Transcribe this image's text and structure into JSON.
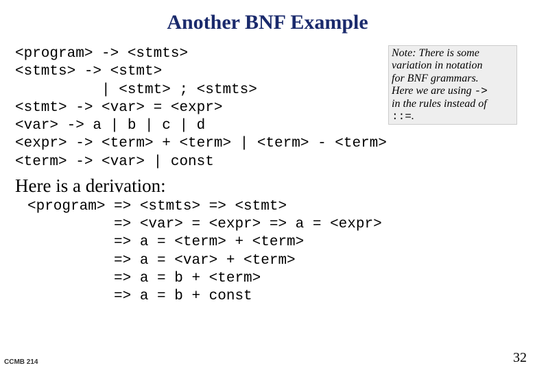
{
  "title": "Another BNF  Example",
  "grammar": [
    "<program> -> <stmts>",
    "<stmts> -> <stmt>",
    "          | <stmt> ; <stmts>",
    "<stmt> -> <var> = <expr>",
    "<var> -> a | b | c | d",
    "<expr> -> <term> + <term> | <term> - <term>",
    "<term> -> <var> | const"
  ],
  "note": {
    "l1": "Note: There is some",
    "l2": "variation in notation",
    "l3": "for BNF grammars.",
    "l4": "Here we are using ",
    "arrow": "->",
    "l5": "in the rules instead of",
    "alt": "::=",
    "dot": "."
  },
  "subheading": "Here is a  derivation:",
  "derivation": [
    "<program> => <stmts> => <stmt>",
    "          => <var> = <expr> => a = <expr>",
    "          => a = <term> + <term>",
    "          => a = <var> + <term>",
    "          => a = b + <term>",
    "          => a = b + const"
  ],
  "footer_left": "CCMB 214",
  "footer_right": "32"
}
